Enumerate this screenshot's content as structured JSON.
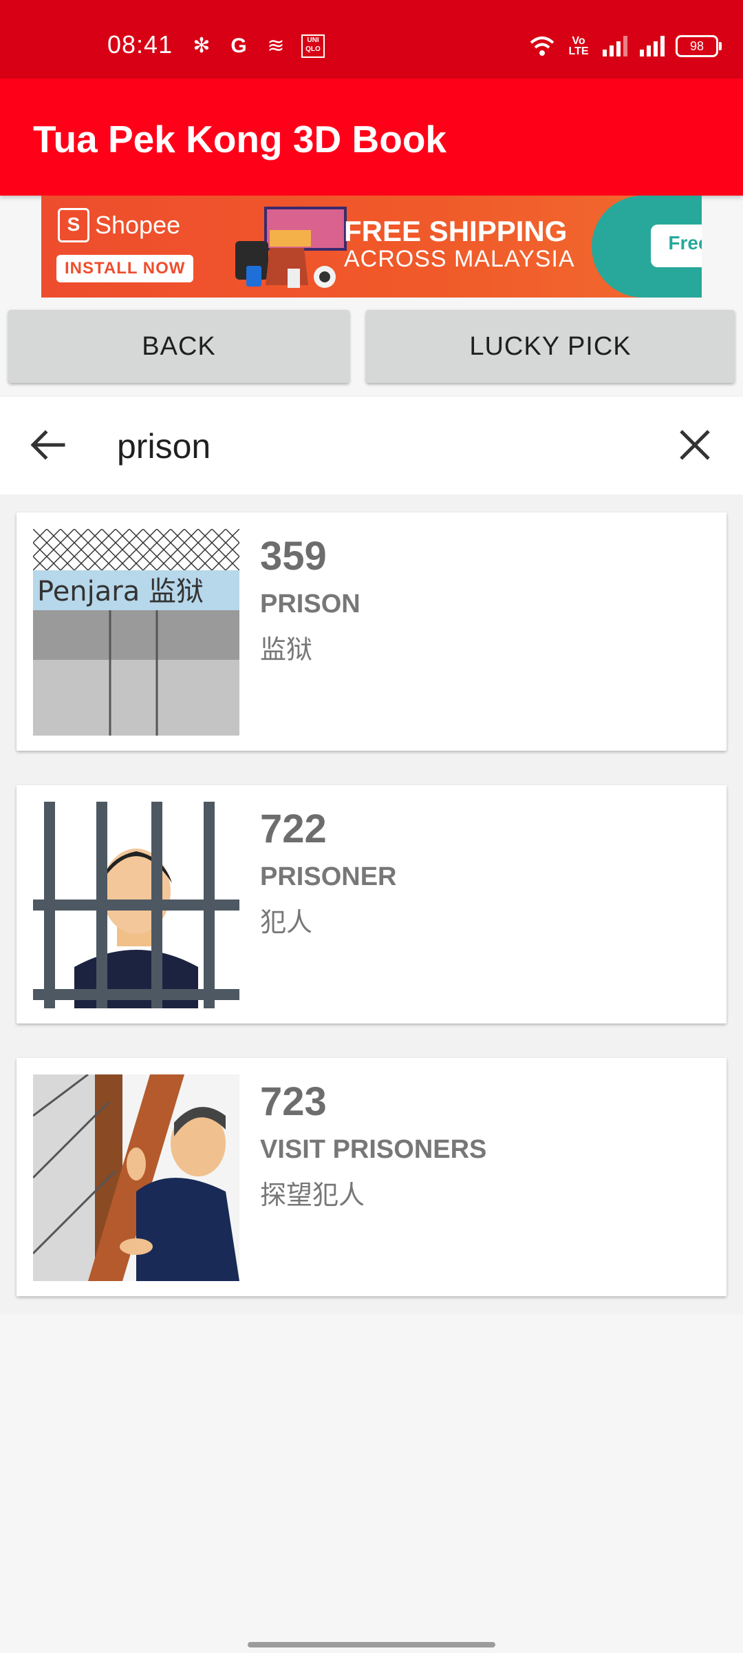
{
  "status_bar": {
    "time": "08:41",
    "left_icons": [
      "fan-icon",
      "google-icon",
      "flag-icon",
      "uniqlo-icon"
    ],
    "uniqlo_text": "UNI QLO",
    "volte": "Vo LTE",
    "battery": "98"
  },
  "app_bar": {
    "title": "Tua Pek Kong 3D Book"
  },
  "banner": {
    "brand": "Shopee",
    "install": "INSTALL NOW",
    "headline": "FREE SHIPPING",
    "sub": "ACROSS MALAYSIA",
    "badge": "Free"
  },
  "buttons": {
    "back": "BACK",
    "lucky_pick": "LUCKY PICK"
  },
  "search": {
    "value": "prison"
  },
  "results": [
    {
      "number": "359",
      "english": "PRISON",
      "chinese": "监狱",
      "image_caption": "Penjara 监狱"
    },
    {
      "number": "722",
      "english": "PRISONER",
      "chinese": "犯人"
    },
    {
      "number": "723",
      "english": "VISIT PRISONERS",
      "chinese": "探望犯人"
    }
  ],
  "colors": {
    "status_bar": "#d80014",
    "app_bar": "#ff0019",
    "shopee_orange": "#ee4d2d",
    "free_teal": "#27a89b"
  }
}
